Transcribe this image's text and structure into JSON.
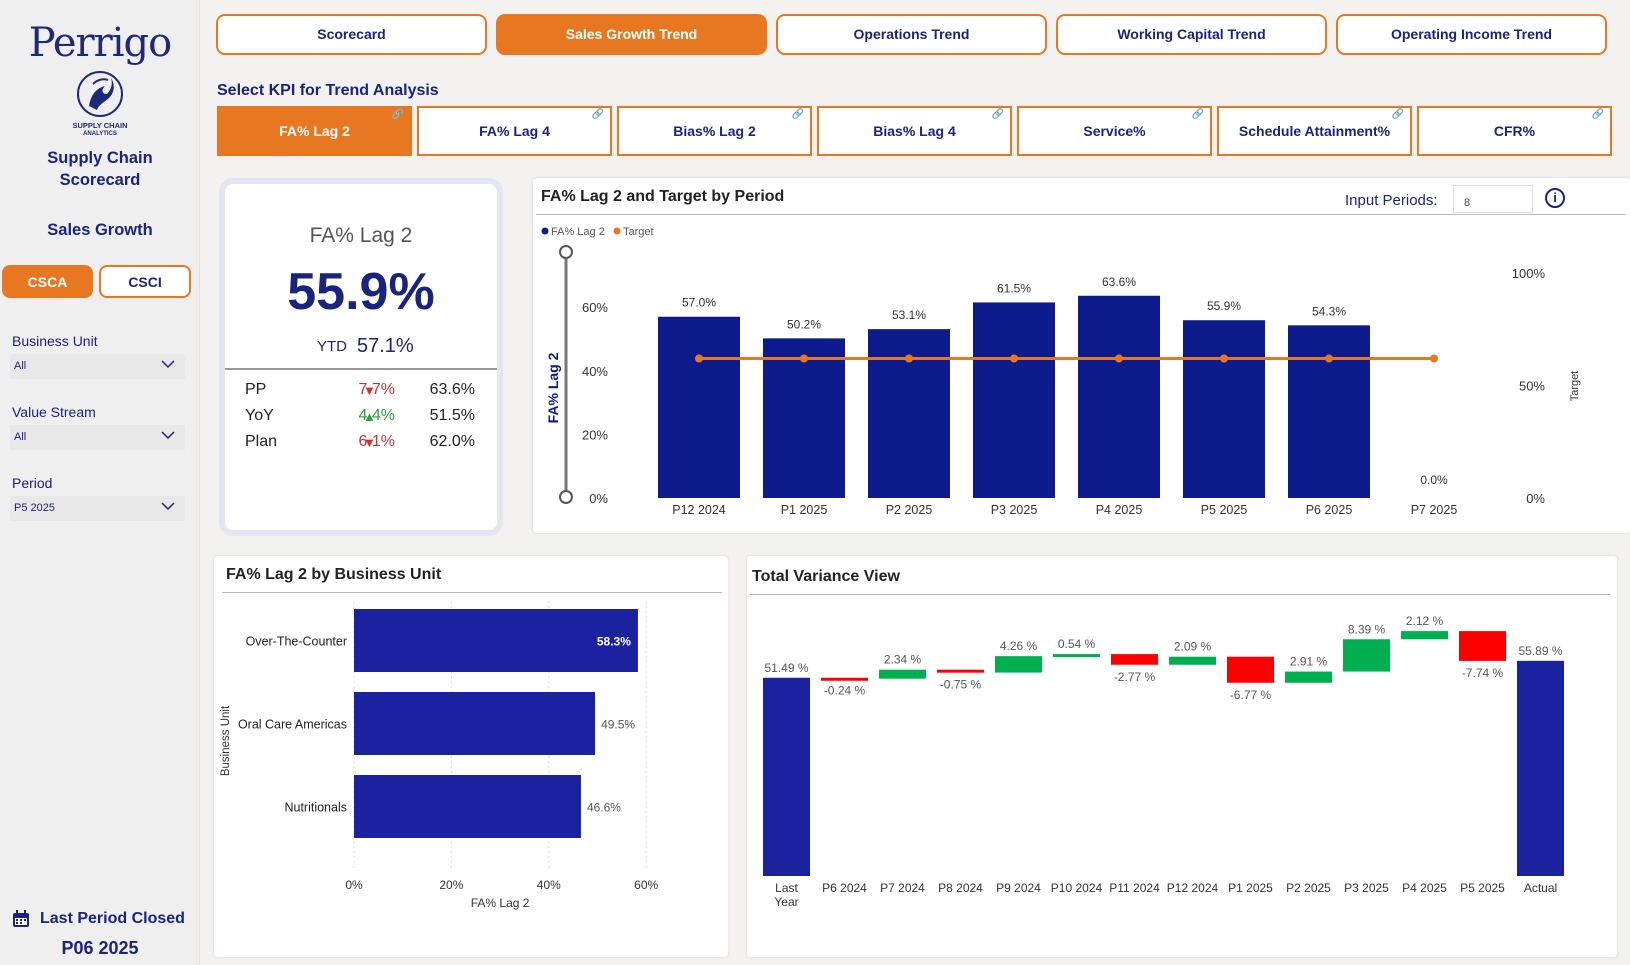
{
  "sidebar": {
    "logo": {
      "brand": "Perrigo",
      "sub_line1": "SUPPLY CHAIN",
      "sub_line2": "ANALYTICS"
    },
    "title_line1": "Supply Chain",
    "title_line2": "Scorecard",
    "section": "Sales Growth",
    "toggles": [
      {
        "label": "CSCA",
        "active": true
      },
      {
        "label": "CSCI",
        "active": false
      }
    ],
    "filters": [
      {
        "label": "Business Unit",
        "value": "All"
      },
      {
        "label": "Value Stream",
        "value": "All"
      },
      {
        "label": "Period",
        "value": "P5 2025"
      }
    ],
    "last_period_label": "Last Period Closed",
    "last_period_value": "P06 2025"
  },
  "nav": {
    "tabs": [
      {
        "label": "Scorecard",
        "active": false
      },
      {
        "label": "Sales Growth Trend",
        "active": true
      },
      {
        "label": "Operations Trend",
        "active": false
      },
      {
        "label": "Working Capital Trend",
        "active": false
      },
      {
        "label": "Operating Income Trend",
        "active": false
      }
    ]
  },
  "kpi_select": {
    "heading": "Select KPI for Trend Analysis",
    "buttons": [
      {
        "label": "FA% Lag 2",
        "active": true
      },
      {
        "label": "FA% Lag 4",
        "active": false
      },
      {
        "label": "Bias% Lag 2",
        "active": false
      },
      {
        "label": "Bias% Lag 4",
        "active": false
      },
      {
        "label": "Service%",
        "active": false
      },
      {
        "label": "Schedule Attainment%",
        "active": false
      },
      {
        "label": "CFR%",
        "active": false
      }
    ]
  },
  "kpi_card": {
    "name": "FA% Lag 2",
    "value": "55.9%",
    "ytd_label": "YTD",
    "ytd_value": "57.1%",
    "rows": [
      {
        "label": "PP",
        "arrow": "▼",
        "trend": "neg",
        "delta": "7.7%",
        "value": "63.6%"
      },
      {
        "label": "YoY",
        "arrow": "▲",
        "trend": "pos",
        "delta": "4.4%",
        "value": "51.5%"
      },
      {
        "label": "Plan",
        "arrow": "▼",
        "trend": "neg",
        "delta": "6.1%",
        "value": "62.0%"
      }
    ]
  },
  "trend": {
    "input_label": "Input Periods:",
    "input_value": "8"
  },
  "colors": {
    "navy": "#0d1b8c",
    "orange": "#e87722",
    "green": "#00b050",
    "red": "#ff0000",
    "waterfall_total": "#1a22a0"
  },
  "chart_data": [
    {
      "type": "bar",
      "title": "FA% Lag 2 and Target by Period",
      "ylabel": "FA% Lag 2",
      "y2label": "Target",
      "legend": [
        "FA% Lag 2",
        "Target"
      ],
      "legend_position": "top-left",
      "categories": [
        "P12 2024",
        "P1 2025",
        "P2 2025",
        "P3 2025",
        "P4 2025",
        "P5 2025",
        "P6 2025",
        "P7 2025"
      ],
      "series": [
        {
          "name": "FA% Lag 2",
          "type": "bar",
          "values": [
            57.0,
            50.2,
            53.1,
            61.5,
            63.6,
            55.9,
            54.3,
            0.0
          ]
        },
        {
          "name": "Target",
          "type": "line",
          "values": [
            62,
            62,
            62,
            62,
            62,
            62,
            62,
            62
          ]
        }
      ],
      "data_labels": [
        "57.0%",
        "50.2%",
        "53.1%",
        "61.5%",
        "63.6%",
        "55.9%",
        "54.3%",
        "0.0%"
      ],
      "ylim": [
        0,
        72
      ],
      "yticks": [
        "0%",
        "20%",
        "40%",
        "60%"
      ],
      "y2ticks": [
        "0%",
        "50%",
        "100%"
      ]
    },
    {
      "type": "bar",
      "orientation": "horizontal",
      "title": "FA% Lag 2 by Business Unit",
      "xlabel": "FA% Lag 2",
      "ylabel": "Business Unit",
      "categories": [
        "Over-The-Counter",
        "Oral Care Americas",
        "Nutritionals"
      ],
      "values": [
        58.3,
        49.5,
        46.6
      ],
      "data_labels": [
        "58.3%",
        "49.5%",
        "46.6%"
      ],
      "xlim": [
        0,
        60
      ],
      "xticks": [
        "0%",
        "20%",
        "40%",
        "60%"
      ]
    },
    {
      "type": "bar",
      "subtype": "waterfall",
      "title": "Total Variance View",
      "steps": [
        {
          "label": "Last Year",
          "value": 51.49,
          "kind": "total",
          "text": "51.49 %"
        },
        {
          "label": "P6 2024",
          "value": -0.24,
          "kind": "delta",
          "text": "-0.24 %"
        },
        {
          "label": "P7 2024",
          "value": 2.34,
          "kind": "delta",
          "text": "2.34 %"
        },
        {
          "label": "P8 2024",
          "value": -0.75,
          "kind": "delta",
          "text": "-0.75 %"
        },
        {
          "label": "P9 2024",
          "value": 4.26,
          "kind": "delta",
          "text": "4.26 %"
        },
        {
          "label": "P10 2024",
          "value": 0.54,
          "kind": "delta",
          "text": "0.54 %"
        },
        {
          "label": "P11 2024",
          "value": -2.77,
          "kind": "delta",
          "text": "-2.77 %"
        },
        {
          "label": "P12 2024",
          "value": 2.09,
          "kind": "delta",
          "text": "2.09 %"
        },
        {
          "label": "P1 2025",
          "value": -6.77,
          "kind": "delta",
          "text": "-6.77 %"
        },
        {
          "label": "P2 2025",
          "value": 2.91,
          "kind": "delta",
          "text": "2.91 %"
        },
        {
          "label": "P3 2025",
          "value": 8.39,
          "kind": "delta",
          "text": "8.39 %"
        },
        {
          "label": "P4 2025",
          "value": 2.12,
          "kind": "delta",
          "text": "2.12 %"
        },
        {
          "label": "P5 2025",
          "value": -7.74,
          "kind": "delta",
          "text": "-7.74 %"
        },
        {
          "label": "Actual",
          "value": 55.89,
          "kind": "total",
          "text": "55.89 %"
        }
      ]
    }
  ]
}
